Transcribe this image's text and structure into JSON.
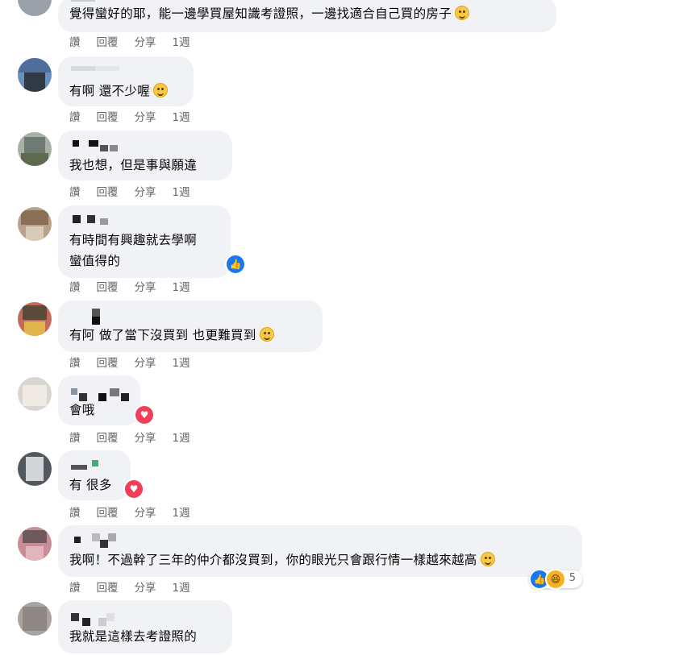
{
  "actions": {
    "like": "讚",
    "reply": "回覆",
    "share": "分享",
    "time": "1週"
  },
  "comments": [
    {
      "text": "覺得蠻好的耶，能一邊學買屋知識考證照，一邊找適合自己買的房子",
      "reaction": null,
      "reaction_count": ""
    },
    {
      "text": "有啊 還不少喔",
      "reaction": null,
      "reaction_count": ""
    },
    {
      "text": "我也想，但是事與願違",
      "reaction": null,
      "reaction_count": ""
    },
    {
      "text_lines": [
        "有時間有興趣就去學啊",
        "蠻值得的"
      ],
      "reaction": "like-icon",
      "reaction_count": ""
    },
    {
      "text": "有阿 做了當下沒買到 也更難買到",
      "reaction": null,
      "reaction_count": ""
    },
    {
      "text": "會哦",
      "reaction": "love-icon",
      "reaction_count": ""
    },
    {
      "text": "有 很多",
      "reaction": "love-icon",
      "reaction_count": ""
    },
    {
      "text": "我啊！不過幹了三年的仲介都沒買到，你的眼光只會跟行情一樣越來越高",
      "reaction": "like-haha-icons",
      "reaction_count": "5"
    },
    {
      "text": "我就是這樣去考證照的",
      "reaction": null,
      "reaction_count": ""
    }
  ],
  "colors": {
    "bubble": "#f0f2f5",
    "action_text": "#65676b",
    "like_blue": "#1877f2",
    "love_red": "#f33e58",
    "haha_yellow": "#f7b125"
  }
}
